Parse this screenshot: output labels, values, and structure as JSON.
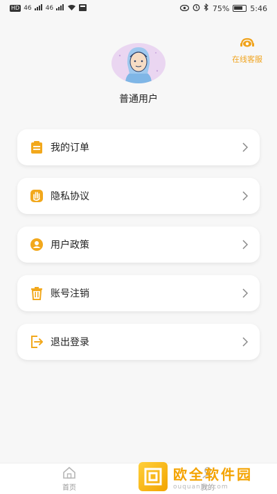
{
  "status_bar": {
    "left_badges": [
      "HD",
      "46",
      "46"
    ],
    "battery_percent": "75%",
    "time": "5:46"
  },
  "service": {
    "label": "在线客服",
    "icon": "headset-icon",
    "accent": "#f0a31c"
  },
  "profile": {
    "username": "普通用户",
    "avatar": "avatar-icon"
  },
  "menu": [
    {
      "label": "我的订单",
      "icon": "order-list-icon"
    },
    {
      "label": "隐私协议",
      "icon": "hand-icon"
    },
    {
      "label": "用户政策",
      "icon": "user-policy-icon"
    },
    {
      "label": "账号注销",
      "icon": "trash-icon"
    },
    {
      "label": "退出登录",
      "icon": "logout-icon"
    }
  ],
  "tabbar": {
    "home_label": "首页",
    "mine_label": "我的"
  },
  "watermark": {
    "title": "欧全软件园",
    "url": "ouquanjin.com"
  }
}
